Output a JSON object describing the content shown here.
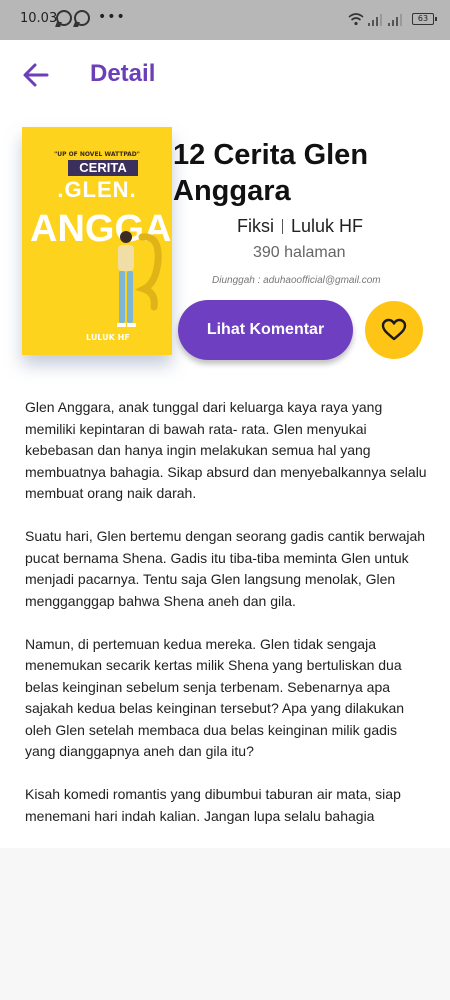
{
  "status_bar": {
    "time": "10.03",
    "dots": "•••",
    "battery": "63"
  },
  "app_bar": {
    "title": "Detail"
  },
  "book": {
    "cover": {
      "top_text": "\"UP OF NOVEL WATTPAD\"",
      "cerita": "CERITA",
      "glen": ".GLEN.",
      "big": "ANGGARA",
      "author": "LULUK HF"
    },
    "title": "12 Cerita Glen Anggara",
    "genre": "Fiksi",
    "author": "Luluk HF",
    "pages": "390 halaman",
    "uploader": "Diunggah : aduhaoofficial@gmail.com"
  },
  "actions": {
    "comment_label": "Lihat Komentar"
  },
  "synopsis": [
    "Glen Anggara, anak tunggal dari keluarga kaya raya yang memiliki kepintaran di bawah rata- rata. Glen menyukai kebebasan dan hanya ingin melakukan semua hal yang membuatnya bahagia. Sikap absurd dan menyebalkannya selalu membuat orang naik darah.",
    "Suatu hari, Glen bertemu dengan seorang gadis cantik berwajah pucat bernama Shena. Gadis itu tiba-tiba meminta Glen untuk menjadi pacarnya. Tentu saja Glen langsung menolak, Glen mengganggap bahwa Shena aneh dan gila.",
    "Namun, di pertemuan kedua mereka. Glen tidak sengaja menemukan secarik kertas milik Shena yang bertuliskan dua belas keinginan sebelum senja terbenam. Sebenarnya apa sajakah kedua belas keinginan tersebut? Apa yang dilakukan oleh Glen setelah membaca dua belas keinginan milik gadis yang dianggapnya aneh dan gila itu?",
    "Kisah komedi romantis yang dibumbui taburan air mata, siap menemani hari indah kalian. Jangan lupa selalu bahagia"
  ],
  "colors": {
    "accent": "#6a3fb8",
    "button": "#6e3fc1",
    "favorite": "#fec516",
    "cover": "#fdd31d"
  },
  "icons": [
    "whatsapp-icon",
    "whatsapp-icon",
    "wifi-icon",
    "signal-icon",
    "battery-icon",
    "back-arrow-icon",
    "heart-icon"
  ]
}
